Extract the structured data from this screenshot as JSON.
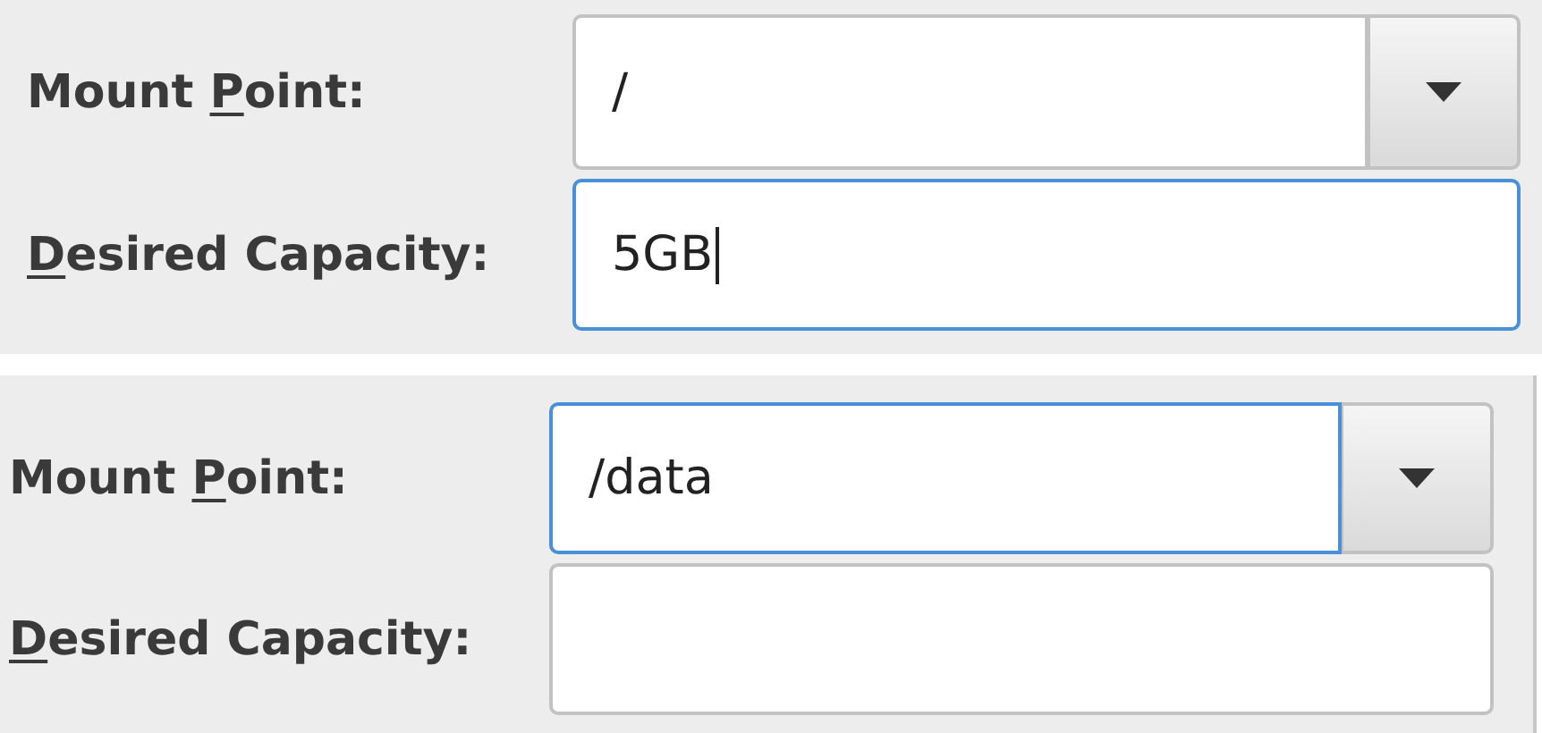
{
  "panels": [
    {
      "mount_point": {
        "label": {
          "before": "Mount ",
          "mnemonic": "P",
          "after": "oint:"
        },
        "value": "/",
        "focused": false
      },
      "desired_capacity": {
        "label": {
          "mnemonic": "D",
          "after": "esired Capacity:"
        },
        "value": "5GB",
        "focused": true,
        "cursor": true
      }
    },
    {
      "mount_point": {
        "label": {
          "before": "Mount ",
          "mnemonic": "P",
          "after": "oint:"
        },
        "value": "/data",
        "focused": true
      },
      "desired_capacity": {
        "label": {
          "mnemonic": "D",
          "after": "esired Capacity:"
        },
        "focused": false,
        "cursor": false
      }
    }
  ]
}
